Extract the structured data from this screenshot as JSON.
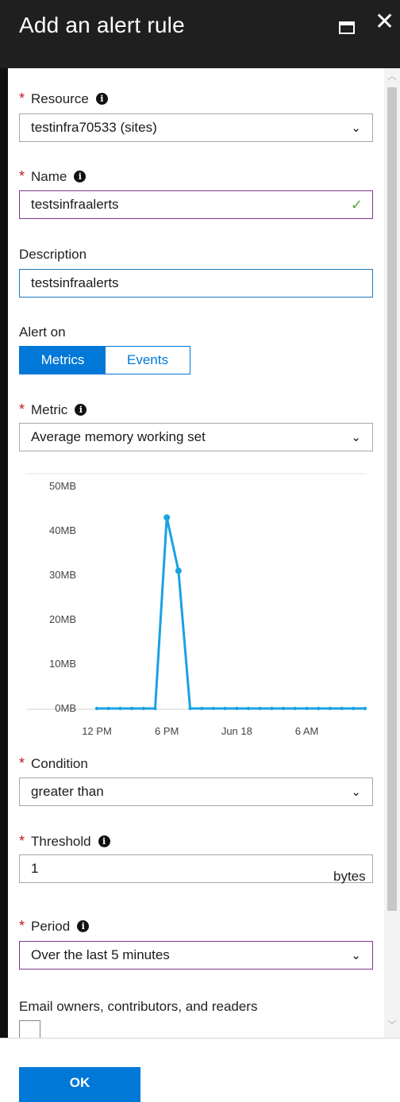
{
  "window": {
    "title": "Add an alert rule",
    "maximize_icon": "maximize-icon",
    "close_icon": "close-icon"
  },
  "resource": {
    "label": "Resource",
    "required_marker": "*",
    "value": "testinfra70533 (sites)"
  },
  "name": {
    "label": "Name",
    "required_marker": "*",
    "value": "testsinfraalerts",
    "valid_icon": "checkmark-icon"
  },
  "description": {
    "label": "Description",
    "value": "testsinfraalerts"
  },
  "alert_on": {
    "label": "Alert on",
    "options": [
      "Metrics",
      "Events"
    ],
    "selected": "Metrics"
  },
  "metric": {
    "label": "Metric",
    "required_marker": "*",
    "value": "Average memory working set"
  },
  "chart_data": {
    "type": "line",
    "title": "",
    "xlabel": "",
    "ylabel": "",
    "y_tick_labels": [
      "50MB",
      "40MB",
      "30MB",
      "20MB",
      "10MB",
      "0MB"
    ],
    "y_ticks": [
      50,
      40,
      30,
      20,
      10,
      0
    ],
    "ylim": [
      0,
      50
    ],
    "y_unit": "MB",
    "x_tick_labels": [
      "12 PM",
      "6 PM",
      "Jun 18",
      "6 AM"
    ],
    "x_tick_index": [
      0,
      6,
      12,
      18
    ],
    "grid": "top-border-only",
    "series": [
      {
        "color": "#1ba1e2",
        "values": [
          0,
          0,
          0,
          0,
          0,
          0,
          43,
          31,
          0,
          0,
          0,
          0,
          0,
          0,
          0,
          0,
          0,
          0,
          0,
          0,
          0,
          0,
          0,
          0
        ]
      }
    ]
  },
  "condition": {
    "label": "Condition",
    "required_marker": "*",
    "value": "greater than"
  },
  "threshold": {
    "label": "Threshold",
    "required_marker": "*",
    "value": "1",
    "unit": "bytes"
  },
  "period": {
    "label": "Period",
    "required_marker": "*",
    "value": "Over the last 5 minutes"
  },
  "email": {
    "label": "Email owners, contributors, and readers",
    "checked": false
  },
  "footer": {
    "ok_label": "OK"
  },
  "colors": {
    "accent": "#0078d7",
    "required": "#c0181c",
    "focused_border": "#7b3a8a",
    "valid": "#5aa832"
  }
}
